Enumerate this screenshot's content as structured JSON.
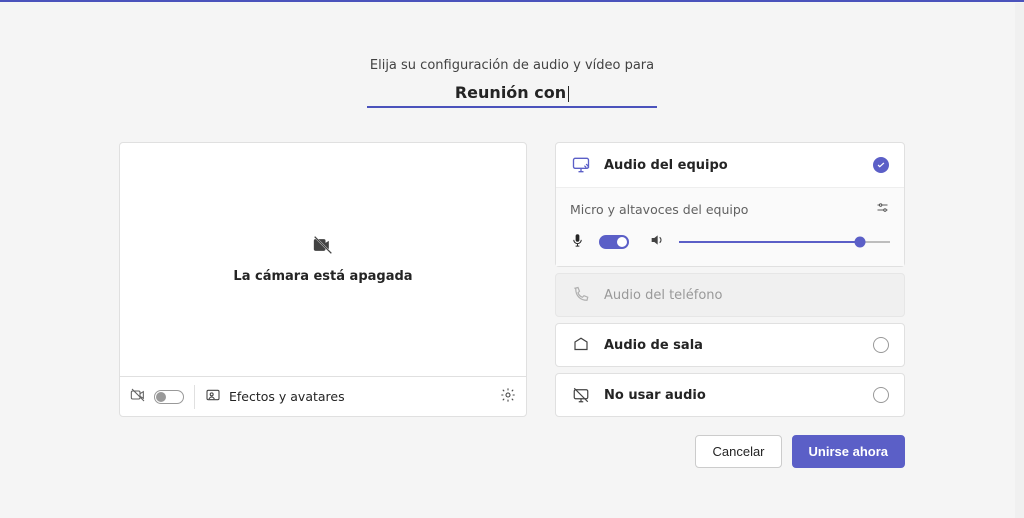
{
  "header": {
    "subtitle": "Elija su configuración de audio y vídeo para",
    "title": "Reunión con"
  },
  "video": {
    "camera_off_text": "La cámara está apagada",
    "effects_label": "Efectos y avatares"
  },
  "audio": {
    "computer": {
      "label": "Audio del equipo",
      "selected": true
    },
    "devices_label": "Micro y altavoces del equipo",
    "phone": {
      "label": "Audio del teléfono"
    },
    "room": {
      "label": "Audio de sala"
    },
    "none": {
      "label": "No usar audio"
    }
  },
  "footer": {
    "cancel": "Cancelar",
    "join": "Unirse ahora"
  }
}
